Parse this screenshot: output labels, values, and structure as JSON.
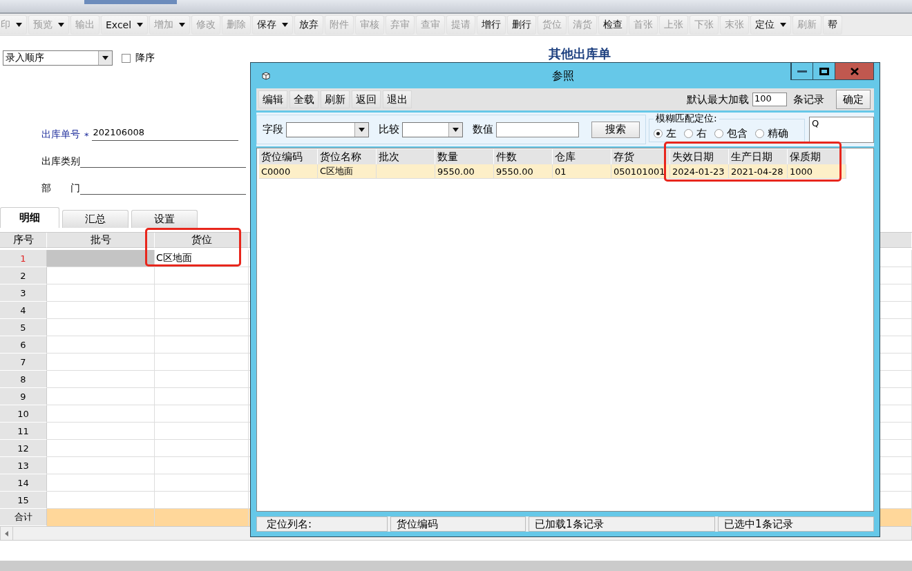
{
  "toolbar": [
    {
      "label": "印",
      "dropdown": true,
      "disabled": true
    },
    {
      "label": "预览",
      "dropdown": true,
      "disabled": true
    },
    {
      "label": "输出",
      "dropdown": false,
      "disabled": true
    },
    {
      "label": "Excel",
      "dropdown": true,
      "disabled": false
    },
    {
      "label": "增加",
      "dropdown": true,
      "disabled": true
    },
    {
      "label": "修改",
      "dropdown": false,
      "disabled": true
    },
    {
      "label": "删除",
      "dropdown": false,
      "disabled": true
    },
    {
      "label": "保存",
      "dropdown": true,
      "disabled": false
    },
    {
      "label": "放弃",
      "dropdown": false,
      "disabled": false
    },
    {
      "label": "附件",
      "dropdown": false,
      "disabled": true
    },
    {
      "label": "审核",
      "dropdown": false,
      "disabled": true
    },
    {
      "label": "弃审",
      "dropdown": false,
      "disabled": true
    },
    {
      "label": "查审",
      "dropdown": false,
      "disabled": true
    },
    {
      "label": "提请",
      "dropdown": false,
      "disabled": true
    },
    {
      "label": "增行",
      "dropdown": false,
      "disabled": false
    },
    {
      "label": "删行",
      "dropdown": false,
      "disabled": false
    },
    {
      "label": "货位",
      "dropdown": false,
      "disabled": true
    },
    {
      "label": "清货",
      "dropdown": false,
      "disabled": true
    },
    {
      "label": "检查",
      "dropdown": false,
      "disabled": false
    },
    {
      "label": "首张",
      "dropdown": false,
      "disabled": true
    },
    {
      "label": "上张",
      "dropdown": false,
      "disabled": true
    },
    {
      "label": "下张",
      "dropdown": false,
      "disabled": true
    },
    {
      "label": "末张",
      "dropdown": false,
      "disabled": true
    },
    {
      "label": "定位",
      "dropdown": true,
      "disabled": false
    },
    {
      "label": "刷新",
      "dropdown": false,
      "disabled": true
    },
    {
      "label": "帮",
      "dropdown": false,
      "disabled": false
    }
  ],
  "sort": {
    "value": "录入顺序",
    "descending": {
      "label": "降序",
      "checked": false
    }
  },
  "form_title": "其他出库单",
  "fields": [
    {
      "label": "出库单号",
      "required": true,
      "marker": "*",
      "value": "202106008"
    },
    {
      "label": "出库类别",
      "required": false
    },
    {
      "label": "部　　门",
      "required": false
    }
  ],
  "tabs": [
    {
      "label": "明细",
      "selected": true
    },
    {
      "label": "汇总",
      "selected": false
    },
    {
      "label": "设置",
      "selected": false
    }
  ],
  "grid": {
    "columns": [
      "序号",
      "批号",
      "货位"
    ],
    "rows": [
      {
        "no": "1",
        "current": true,
        "location": "C区地面"
      },
      {
        "no": "2",
        "current": false
      },
      {
        "no": "3",
        "current": false
      },
      {
        "no": "4",
        "current": false
      },
      {
        "no": "5",
        "current": false
      },
      {
        "no": "6",
        "current": false
      },
      {
        "no": "7",
        "current": false
      },
      {
        "no": "8",
        "current": false
      },
      {
        "no": "9",
        "current": false
      },
      {
        "no": "10",
        "current": false
      },
      {
        "no": "11",
        "current": false
      },
      {
        "no": "12",
        "current": false
      },
      {
        "no": "13",
        "current": false
      },
      {
        "no": "14",
        "current": false
      },
      {
        "no": "15",
        "current": false
      }
    ],
    "total_label": "合计"
  },
  "dialog": {
    "title": "参照",
    "toolbar": [
      "编辑",
      "全载",
      "刷新",
      "返回",
      "退出"
    ],
    "max_load": {
      "label": "默认最大加载",
      "value": "100",
      "suffix": "条记录"
    },
    "confirm": "确定",
    "filter": {
      "field_label": "字段",
      "compare_label": "比较",
      "value_label": "数值",
      "search": "搜索"
    },
    "fuzzy": {
      "title": "模糊匹配定位:",
      "options": [
        {
          "label": "左",
          "selected": true
        },
        {
          "label": "右",
          "selected": false
        },
        {
          "label": "包含",
          "selected": false
        },
        {
          "label": "精确",
          "selected": false
        }
      ]
    },
    "locate_value": "Q",
    "table": {
      "columns": [
        "货位编码",
        "货位名称",
        "批次",
        "数量",
        "件数",
        "仓库",
        "存货",
        "失效日期",
        "生产日期",
        "保质期"
      ],
      "rows": [
        {
          "selected": true,
          "cells": [
            "C0000",
            "C区地面",
            null,
            "9550.00",
            "9550.00",
            "01",
            "050101001",
            "2024-01-23",
            "2021-04-28",
            "1000"
          ]
        }
      ]
    },
    "status": [
      "定位列名:",
      "货位编码",
      "已加载1条记录",
      "已选中1条记录"
    ]
  }
}
